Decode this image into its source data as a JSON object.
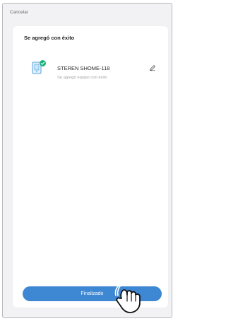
{
  "header": {
    "cancel_label": "Cancelar"
  },
  "card": {
    "title": "Se agregó con éxito",
    "device": {
      "name": "STEREN SHOME-118",
      "status": "Se agregó equipo con éxito",
      "icon": "device-icon",
      "badge_icon": "check-icon",
      "edit_icon": "pencil-icon"
    }
  },
  "actions": {
    "done_label": "Finalizado"
  },
  "colors": {
    "accent": "#3e87d3",
    "check": "#1fb17c",
    "device_icon": "#4fa3e0",
    "background": "#f2f2f4"
  }
}
